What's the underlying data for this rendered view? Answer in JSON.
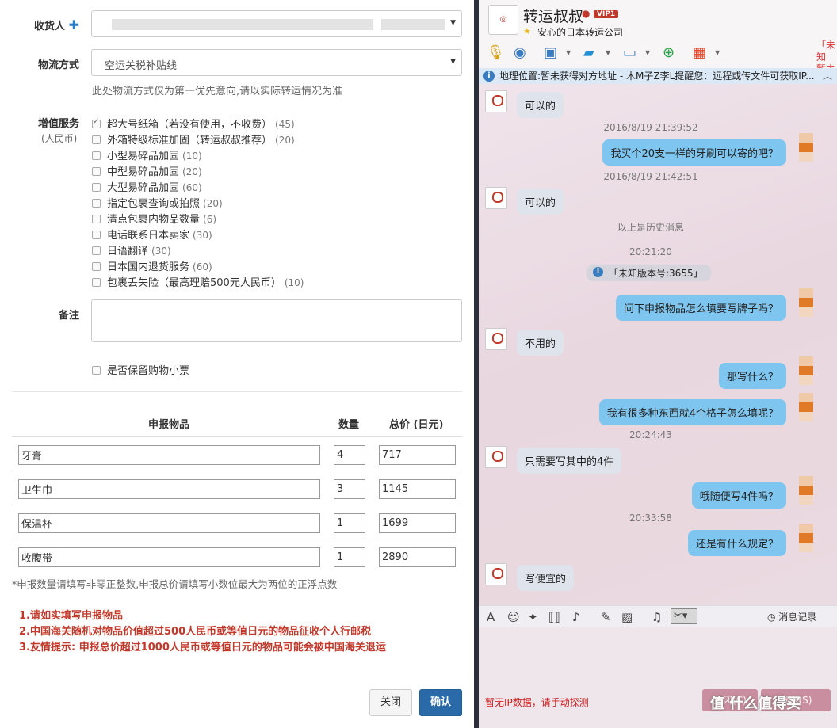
{
  "form": {
    "recipient_label": "收货人",
    "recipient_add_icon": "plus-icon",
    "shipping_label": "物流方式",
    "shipping_value": "空运关税补贴线",
    "shipping_hint": "此处物流方式仅为第一优先意向,请以实际转运情况为准",
    "value_added_label": "增值服务",
    "value_added_sub": "(人民币)",
    "services": [
      {
        "label": "超大号纸箱（若没有使用，不收费）",
        "fee": "(45)",
        "checked": true
      },
      {
        "label": "外箱特级标准加固（转运叔叔推荐）",
        "fee": "(20)",
        "checked": false
      },
      {
        "label": "小型易碎品加固",
        "fee": "(10)",
        "checked": false
      },
      {
        "label": "中型易碎品加固",
        "fee": "(20)",
        "checked": false
      },
      {
        "label": "大型易碎品加固",
        "fee": "(60)",
        "checked": false
      },
      {
        "label": "指定包裹查询或拍照",
        "fee": "(20)",
        "checked": false
      },
      {
        "label": "清点包裹内物品数量",
        "fee": "(6)",
        "checked": false
      },
      {
        "label": "电话联系日本卖家",
        "fee": "(30)",
        "checked": false
      },
      {
        "label": "日语翻译",
        "fee": "(30)",
        "checked": false
      },
      {
        "label": "日本国内退货服务",
        "fee": "(60)",
        "checked": false
      },
      {
        "label": "包裹丢失险（最高理赔500元人民币）",
        "fee": "(10)",
        "checked": false
      }
    ],
    "remark_label": "备注",
    "keep_receipt_label": "是否保留购物小票",
    "table_headers": [
      "申报物品",
      "数量",
      "总价 (日元)"
    ],
    "items": [
      {
        "name": "牙膏",
        "qty": "4",
        "price": "717"
      },
      {
        "name": "卫生巾",
        "qty": "3",
        "price": "1145"
      },
      {
        "name": "保温杯",
        "qty": "1",
        "price": "1699"
      },
      {
        "name": "收腹带",
        "qty": "1",
        "price": "2890"
      }
    ],
    "declare_note": "*申报数量请填写非零正整数,申报总价请填写小数位最大为两位的正浮点数",
    "warnings": [
      "1.请如实填写申报物品",
      "2.中国海关随机对物品价值超过500人民币或等值日元的物品征收个人行邮税",
      "3.友情提示: 申报总价超过1000人民币或等值日元的物品可能会被中国海关退运"
    ],
    "close_button": "关闭",
    "confirm_button": "确认"
  },
  "chat": {
    "title": "转运叔叔",
    "vip": "VIP1",
    "subtitle": "安心的日本转运公司",
    "right_edge_text": "「未知",
    "right_edge_text2": "暂未",
    "infobar": "地理位置:暂未获得对方地址 - 木M子Z李L提醒您：远程或传文件可获取IP...",
    "messages": [
      {
        "dir": "in",
        "text": "可以的"
      },
      {
        "dir": "ts",
        "text": "2016/8/19 21:39:52"
      },
      {
        "dir": "out",
        "text": "我买个20支一样的牙刷可以寄的吧？"
      },
      {
        "dir": "ts",
        "text": "2016/8/19 21:42:51"
      },
      {
        "dir": "in",
        "text": "可以的"
      },
      {
        "dir": "ts",
        "text": "以上是历史消息"
      },
      {
        "dir": "ts",
        "text": "20:21:20"
      },
      {
        "dir": "sys",
        "text": "「未知版本号:3655」"
      },
      {
        "dir": "out",
        "text": "问下申报物品怎么填要写牌子吗？"
      },
      {
        "dir": "in",
        "text": "不用的"
      },
      {
        "dir": "out",
        "text": "那写什么？"
      },
      {
        "dir": "out",
        "text": "我有很多种东西就4个格子怎么填呢？"
      },
      {
        "dir": "ts",
        "text": "20:24:43"
      },
      {
        "dir": "in",
        "text": "只需要写其中的4件"
      },
      {
        "dir": "out",
        "text": "哦随便写4件吗？"
      },
      {
        "dir": "ts",
        "text": "20:33:58"
      },
      {
        "dir": "out",
        "text": "还是有什么规定？"
      },
      {
        "dir": "in",
        "text": "写便宜的"
      }
    ],
    "history_label": "消息记录",
    "ip_notice": "暂无IP数据，请手动探测",
    "close_btn": "关闭(C)",
    "send_btn": "发送(S)",
    "watermark": "值 什么值得买"
  }
}
